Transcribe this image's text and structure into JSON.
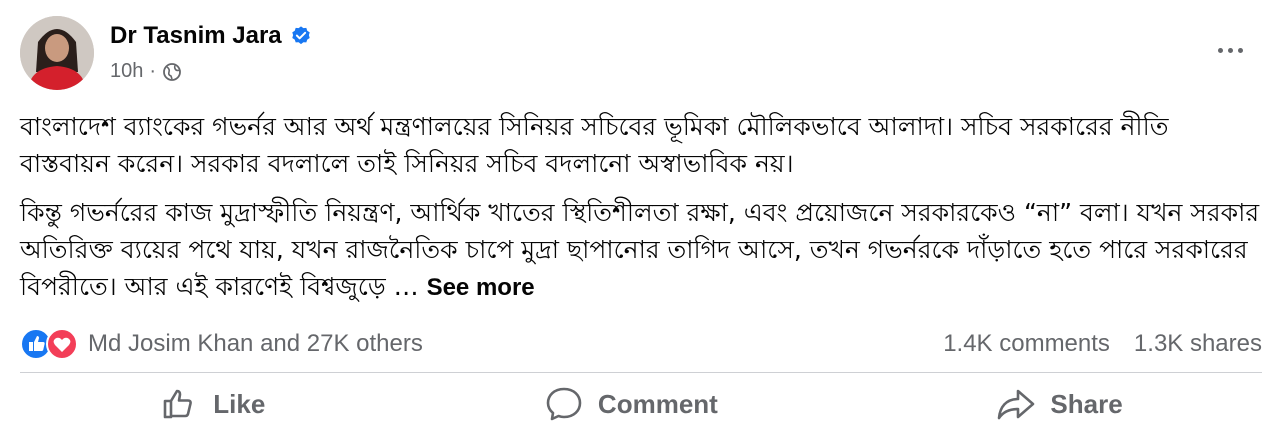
{
  "post": {
    "author": "Dr Tasnim Jara",
    "time": "10h",
    "separator": "·",
    "paragraphs": [
      "বাংলাদেশ ব্যাংকের গভর্নর আর অর্থ মন্ত্রণালয়ের সিনিয়র সচিবের ভূমিকা মৌলিকভাবে আলাদা। সচিব সরকারের নীতি বাস্তবায়ন করেন। সরকার বদলালে তাই সিনিয়র সচিব বদলানো অস্বাভাবিক নয়।",
      "কিন্তু গভর্নরের কাজ মুদ্রাস্ফীতি নিয়ন্ত্রণ, আর্থিক খাতের স্থিতিশীলতা রক্ষা, এবং প্রয়োজনে সরকারকেও “না” বলা। যখন সরকার অতিরিক্ত ব্যয়ের পথে যায়, যখন রাজনৈতিক চাপে মুদ্রা ছাপানোর তাগিদ আসে, তখন গভর্নরকে দাঁড়াতে হতে পারে সরকারের বিপরীতে। আর এই কারণেই বিশ্বজুড়ে …"
    ],
    "see_more": "See more"
  },
  "engagement": {
    "reactions_text": "Md Josim Khan and 27K others",
    "comments": "1.4K comments",
    "shares": "1.3K shares"
  },
  "actions": {
    "like": "Like",
    "comment": "Comment",
    "share": "Share"
  },
  "colors": {
    "like_blue": "#1877f2",
    "love_red": "#f33e58",
    "secondary_text": "#65676b"
  },
  "icons": [
    "verified-badge-icon",
    "globe-icon",
    "more-options-icon",
    "like-reaction-icon",
    "love-reaction-icon",
    "thumbs-up-icon",
    "comment-bubble-icon",
    "share-arrow-icon"
  ]
}
